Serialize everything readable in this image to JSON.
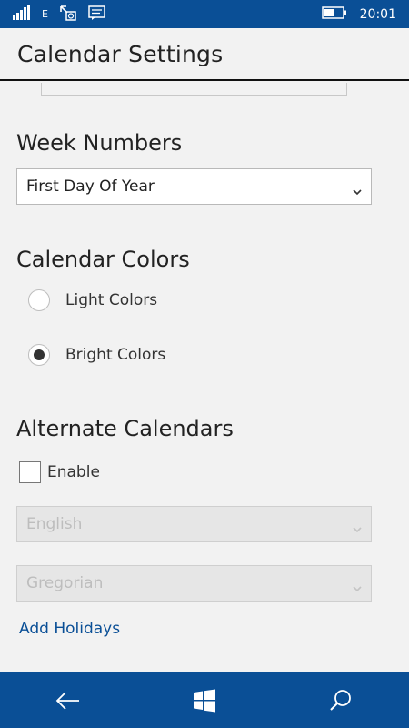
{
  "status_bar": {
    "network_label": "E",
    "time": "20:01"
  },
  "header": {
    "title": "Calendar Settings"
  },
  "week_numbers": {
    "heading": "Week Numbers",
    "selected": "First Day Of Year"
  },
  "calendar_colors": {
    "heading": "Calendar Colors",
    "options": [
      {
        "label": "Light Colors",
        "checked": false
      },
      {
        "label": "Bright Colors",
        "checked": true
      }
    ]
  },
  "alternate_calendars": {
    "heading": "Alternate Calendars",
    "enable_label": "Enable",
    "enabled": false,
    "language_select": "English",
    "calendar_select": "Gregorian"
  },
  "add_holidays_link": "Add Holidays",
  "colors": {
    "accent": "#0a4f96",
    "background": "#f2f2f2"
  }
}
